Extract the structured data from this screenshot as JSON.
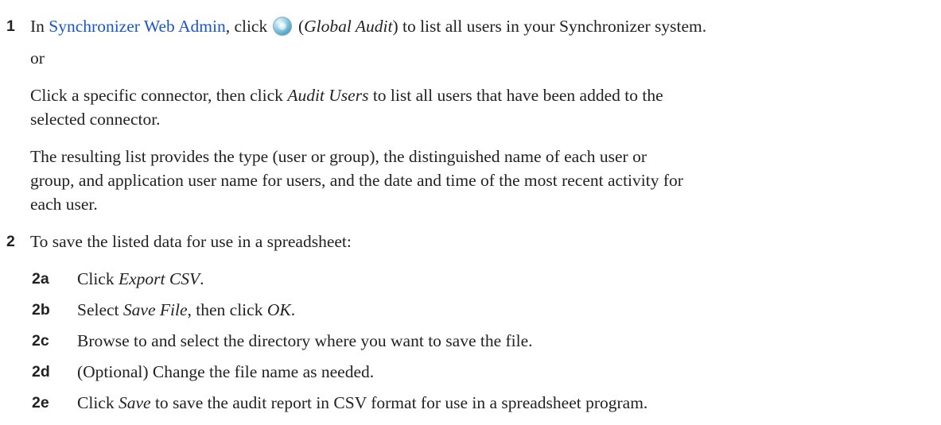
{
  "step1": {
    "number": "1",
    "pre": "In ",
    "link": "Synchronizer Web Admin",
    "mid": ", click ",
    "icon": "global-audit-icon",
    "paren_open": " (",
    "audit_label": "Global Audit",
    "rest": ") to list all users in your Synchronizer system.",
    "or": "or",
    "p2_a": "Click a specific connector, then click ",
    "p2_italic": "Audit Users",
    "p2_b": " to list all users that have been added to the",
    "p2_line2": "selected connector.",
    "p3_line1": "The resulting list provides the type (user or group), the distinguished name of each user or",
    "p3_line2": "group, and application user name for users, and the date and time of the most recent activity for",
    "p3_line3": "each user."
  },
  "step2": {
    "number": "2",
    "intro": "To save the listed data for use in a spreadsheet:",
    "substeps": [
      {
        "label": "2a",
        "pre": "Click ",
        "italic": "Export CSV",
        "post": "."
      },
      {
        "label": "2b",
        "pre": "Select ",
        "italic": "Save File",
        "mid": ", then click ",
        "italic2": "OK",
        "post": "."
      },
      {
        "label": "2c",
        "text": "Browse to and select the directory where you want to save the file."
      },
      {
        "label": "2d",
        "text": "(Optional) Change the file name as needed."
      },
      {
        "label": "2e",
        "pre": "Click ",
        "italic": "Save",
        "post": " to save the audit report in CSV format for use in a spreadsheet program."
      }
    ]
  }
}
